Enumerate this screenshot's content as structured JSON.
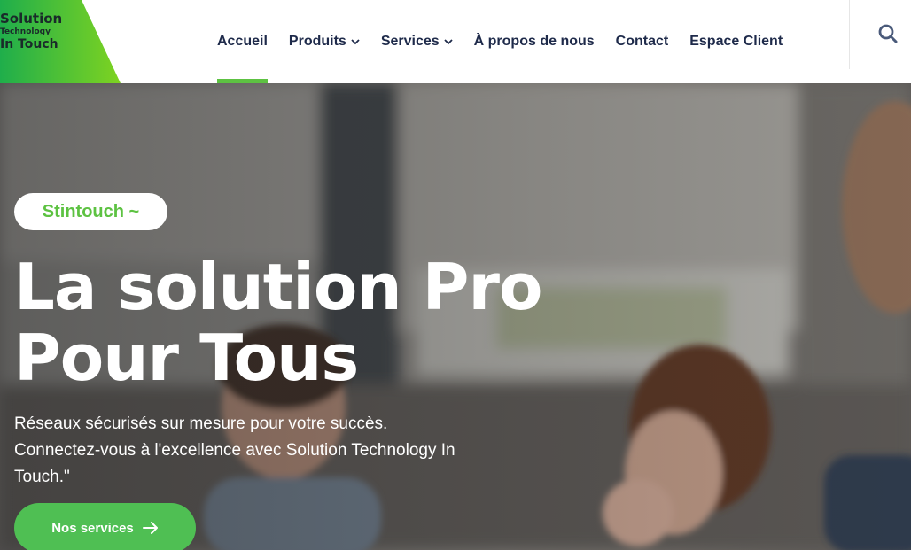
{
  "logo": {
    "line1": "Solution",
    "line2": "Technology",
    "line3": "In Touch",
    "accent": "#5dc242"
  },
  "nav": {
    "items": [
      {
        "label": "Accueil",
        "active": true
      },
      {
        "label": "Produits",
        "dropdown": true
      },
      {
        "label": "Services",
        "dropdown": true
      },
      {
        "label": "À propos de nous"
      },
      {
        "label": "Contact"
      },
      {
        "label": "Espace Client"
      }
    ],
    "chevron": "⌄",
    "search_icon": "search-icon"
  },
  "hero": {
    "tag": "Stintouch ~",
    "title": "La solution Pro Pour Tous",
    "subtitle": "Réseaux sécurisés sur mesure pour votre succès. Connectez-vous à l'excellence avec Solution Technology In Touch.\"",
    "cta_label": "Nos services",
    "cta_icon": "arrow-right-icon"
  },
  "colors": {
    "brand_green": "#5dc242",
    "nav_text": "#1e2a4a",
    "search_icon": "#4a5a7a"
  }
}
